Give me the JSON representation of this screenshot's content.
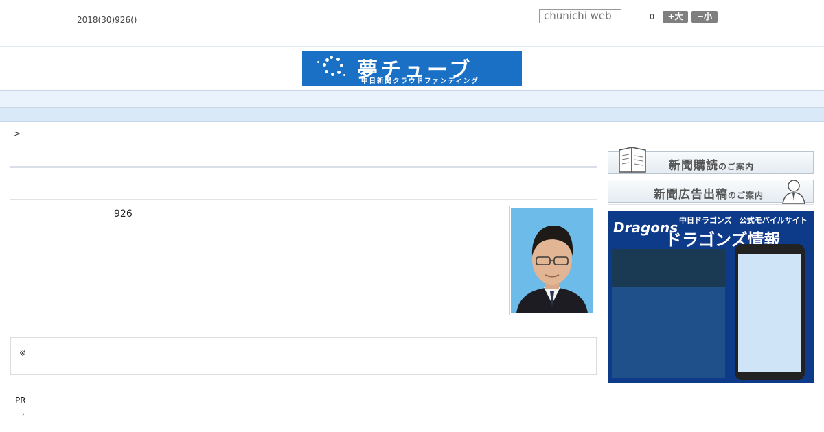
{
  "header": {
    "date_text": "2018(30)926()",
    "search_placeholder": "chunichi web",
    "font_size_value": "0",
    "font_larger": "+大",
    "font_smaller": "−小"
  },
  "banner": {
    "title": "夢チューブ",
    "subtitle": "中日新聞クラウドファンディング"
  },
  "nav": {
    "items": [
      "",
      "",
      "",
      "",
      "",
      "",
      "",
      "",
      ""
    ]
  },
  "breadcrumb": ">",
  "article": {
    "number": "926",
    "note": "※"
  },
  "pr": {
    "label": "PR",
    "arrow": "›"
  },
  "sidebar": {
    "subscribe_label": "新聞購読",
    "subscribe_suffix": "のご案内",
    "advert_label": "新聞広告出稿",
    "advert_suffix": "のご案内",
    "ad": {
      "logo": "Dragons",
      "tag_small": "中日ドラゴンズ　公式モバイルサイト",
      "tag_big": "ドラゴンズ情報"
    }
  }
}
